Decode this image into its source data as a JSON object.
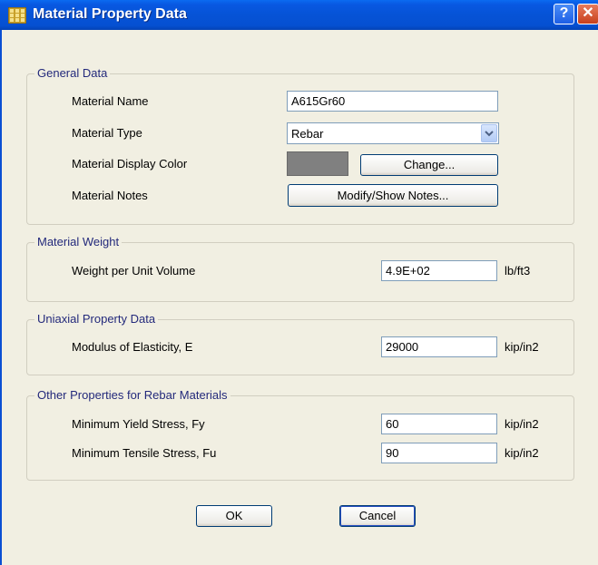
{
  "window": {
    "title": "Material Property Data",
    "help_label": "?",
    "close_label": "✕",
    "icon": "grid-app-icon"
  },
  "general": {
    "legend": "General Data",
    "name_label": "Material Name",
    "name_value": "A615Gr60",
    "type_label": "Material Type",
    "type_value": "Rebar",
    "color_label": "Material Display Color",
    "color_value": "#808080",
    "change_label": "Change...",
    "notes_label": "Material Notes",
    "notes_button": "Modify/Show Notes..."
  },
  "weight": {
    "legend": "Material Weight",
    "label": "Weight per Unit Volume",
    "value": "4.9E+02",
    "unit": "lb/ft3"
  },
  "uniaxial": {
    "legend": "Uniaxial Property Data",
    "label": "Modulus of Elasticity,  E",
    "value": "29000",
    "unit": "kip/in2"
  },
  "rebar": {
    "legend": "Other Properties for Rebar Materials",
    "fy_label": "Minimum Yield Stress, Fy",
    "fy_value": "60",
    "fy_unit": "kip/in2",
    "fu_label": "Minimum Tensile Stress, Fu",
    "fu_value": "90",
    "fu_unit": "kip/in2"
  },
  "buttons": {
    "ok": "OK",
    "cancel": "Cancel"
  }
}
